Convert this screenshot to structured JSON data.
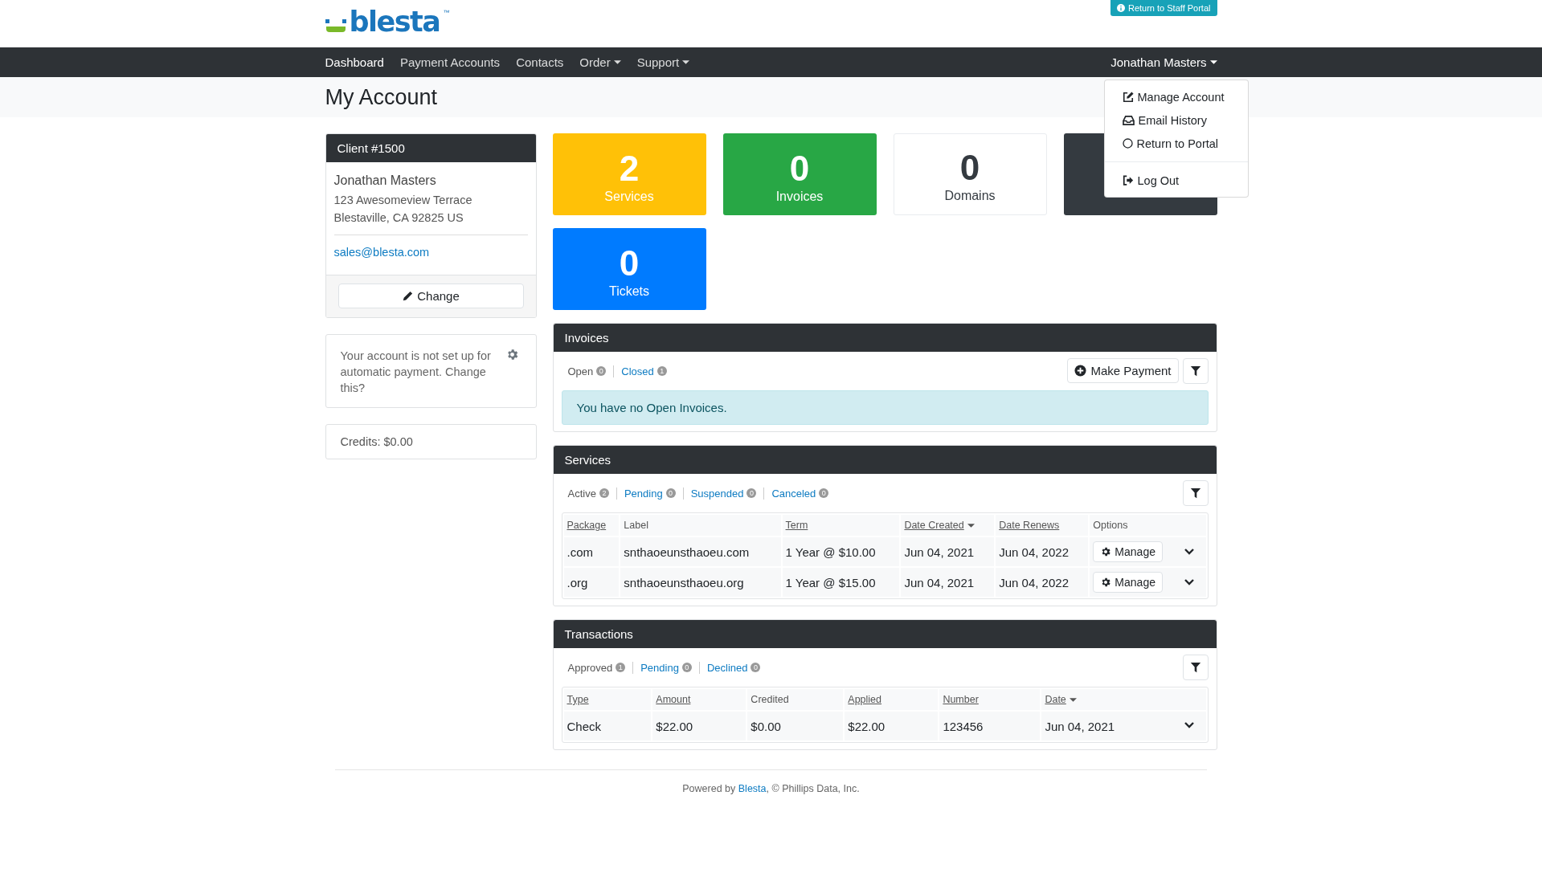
{
  "header": {
    "logo": {
      "text": "blesta",
      "mark": "™"
    },
    "staff_portal_button": "Return to Staff Portal"
  },
  "nav": {
    "items": [
      {
        "label": "Dashboard",
        "selected": true,
        "dropdown": false
      },
      {
        "label": "Payment Accounts",
        "selected": false,
        "dropdown": false
      },
      {
        "label": "Contacts",
        "selected": false,
        "dropdown": false
      },
      {
        "label": "Order",
        "selected": false,
        "dropdown": true
      },
      {
        "label": "Support",
        "selected": false,
        "dropdown": true
      }
    ],
    "user_menu": {
      "label": "Jonathan Masters",
      "expanded": true,
      "groups": [
        {
          "items": [
            "Manage Account",
            "Email History",
            "Return to Portal"
          ]
        },
        {
          "items": [
            "Log Out"
          ]
        }
      ]
    }
  },
  "page_title": "My Account",
  "client": {
    "title": "Client #1500",
    "name": "Jonathan Masters",
    "address": [
      "123 Awesomeview Terrace",
      "Blestaville, CA 92825 US"
    ],
    "email": "sales@blesta.com",
    "change_button": "Change"
  },
  "autopay": {
    "text": "Your account is not set up for automatic payment. Change this?"
  },
  "credits": "Credits: $0.00",
  "stats": [
    {
      "value": "2",
      "label": "Services",
      "color": "#ffc107"
    },
    {
      "value": "0",
      "label": "Invoices",
      "color": "#28a745"
    },
    {
      "value": "0",
      "label": "Domains",
      "color": "#ffffff"
    },
    {
      "color": "#343a40"
    },
    {
      "value": "0",
      "label": "Tickets",
      "color": "#007bff"
    }
  ],
  "panels": [
    {
      "title": "Invoices",
      "filters": [
        {
          "label": "Open",
          "count": "0",
          "selected": true
        },
        {
          "label": "Closed",
          "count": "1",
          "selected": false
        }
      ],
      "actions": [
        "Make Payment"
      ],
      "message": "You have no Open Invoices."
    },
    {
      "title": "Services",
      "filters": [
        {
          "label": "Active",
          "count": "2",
          "selected": true
        },
        {
          "label": "Pending",
          "count": "0",
          "selected": false
        },
        {
          "label": "Suspended",
          "count": "0",
          "selected": false
        },
        {
          "label": "Canceled",
          "count": "0",
          "selected": false
        }
      ],
      "table": {
        "columns": [
          {
            "label": "Package",
            "sortable": true,
            "sorted": false
          },
          {
            "label": "Label",
            "sortable": false,
            "sorted": false
          },
          {
            "label": "Term",
            "sortable": true,
            "sorted": false
          },
          {
            "label": "Date Created",
            "sortable": true,
            "sorted": true
          },
          {
            "label": "Date Renews",
            "sortable": true,
            "sorted": false
          },
          {
            "label": "Options",
            "sortable": false,
            "sorted": false
          }
        ],
        "rows": [
          {
            "cells": [
              ".com",
              "snthaoeunsthaoeu.com",
              "1 Year @ $10.00",
              "Jun 04, 2021",
              "Jun 04, 2022"
            ],
            "button": "Manage",
            "expanded": false
          },
          {
            "cells": [
              ".org",
              "snthaoeunsthaoeu.org",
              "1 Year @ $15.00",
              "Jun 04, 2021",
              "Jun 04, 2022"
            ],
            "button": "Manage",
            "expanded": false
          }
        ]
      }
    },
    {
      "title": "Transactions",
      "filters": [
        {
          "label": "Approved",
          "count": "1",
          "selected": true
        },
        {
          "label": "Pending",
          "count": "0",
          "selected": false
        },
        {
          "label": "Declined",
          "count": "0",
          "selected": false
        }
      ],
      "table": {
        "columns": [
          {
            "label": "Type",
            "sortable": true,
            "sorted": false
          },
          {
            "label": "Amount",
            "sortable": true,
            "sorted": false
          },
          {
            "label": "Credited",
            "sortable": false,
            "sorted": false
          },
          {
            "label": "Applied",
            "sortable": true,
            "sorted": false
          },
          {
            "label": "Number",
            "sortable": true,
            "sorted": false
          },
          {
            "label": "Date",
            "sortable": true,
            "sorted": true
          }
        ],
        "rows": [
          {
            "cells": [
              "Check",
              "$22.00",
              "$0.00",
              "$22.00",
              "123456",
              "Jun 04, 2021"
            ],
            "expanded": false
          }
        ]
      }
    }
  ],
  "footer": {
    "prefix": "Powered by ",
    "link": "Blesta",
    "suffix": ", © Phillips Data, Inc."
  }
}
